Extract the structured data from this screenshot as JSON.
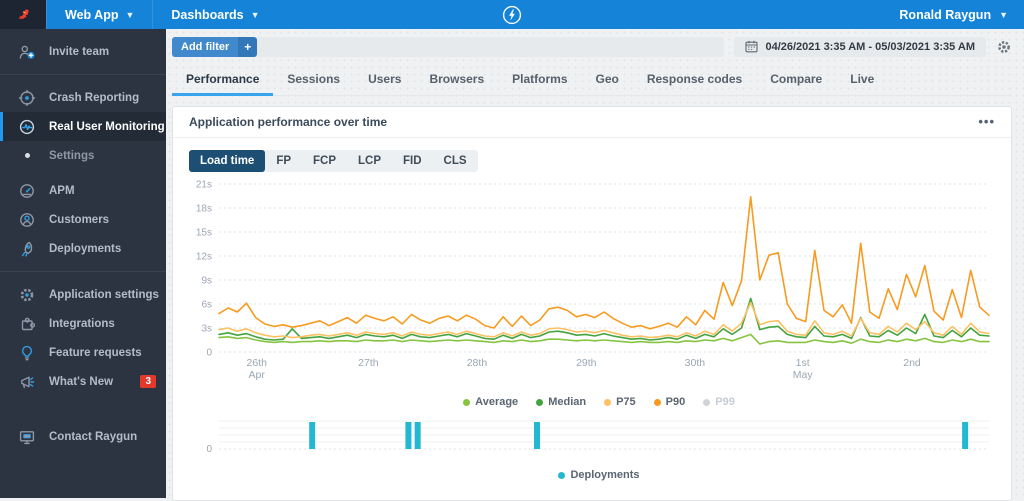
{
  "topbar": {
    "app_label": "Web App",
    "dashboards_label": "Dashboards",
    "user_name": "Ronald Raygun",
    "accent_color": "#1583d7"
  },
  "sidebar": {
    "items": [
      {
        "label": "Invite team",
        "icon": "invite-team-icon"
      },
      {
        "label": "Crash Reporting",
        "icon": "crash-reporting-icon"
      },
      {
        "label": "Real User Monitoring",
        "icon": "real-user-monitoring-icon",
        "active": true
      },
      {
        "label": "Settings",
        "icon": "bullet-dot"
      },
      {
        "label": "APM",
        "icon": "apm-gauge-icon"
      },
      {
        "label": "Customers",
        "icon": "customers-icon"
      },
      {
        "label": "Deployments",
        "icon": "rocket-icon"
      },
      {
        "label": "Application settings",
        "icon": "gear-icon"
      },
      {
        "label": "Integrations",
        "icon": "puzzle-icon"
      },
      {
        "label": "Feature requests",
        "icon": "lightbulb-icon"
      },
      {
        "label": "What's New",
        "icon": "megaphone-icon",
        "badge": "3"
      },
      {
        "label": "Contact Raygun",
        "icon": "contact-icon"
      }
    ]
  },
  "filter_bar": {
    "add_filter_label": "Add filter",
    "plus_label": "+",
    "date_range": "04/26/2021 3:35 AM - 05/03/2021 3:35 AM"
  },
  "tabs": [
    {
      "label": "Performance",
      "active": true
    },
    {
      "label": "Sessions"
    },
    {
      "label": "Users"
    },
    {
      "label": "Browsers"
    },
    {
      "label": "Platforms"
    },
    {
      "label": "Geo"
    },
    {
      "label": "Response codes"
    },
    {
      "label": "Compare"
    },
    {
      "label": "Live"
    }
  ],
  "card": {
    "title": "Application performance over time",
    "menu_label": "•••"
  },
  "toggles": [
    {
      "label": "Load time",
      "active": true
    },
    {
      "label": "FP"
    },
    {
      "label": "FCP"
    },
    {
      "label": "LCP"
    },
    {
      "label": "FID"
    },
    {
      "label": "CLS"
    }
  ],
  "chart_data": {
    "type": "line",
    "title": "Application performance over time",
    "unit": "seconds",
    "ylim": [
      0,
      21
    ],
    "yticks": [
      0,
      3,
      6,
      9,
      12,
      15,
      18,
      21
    ],
    "ytick_labels": [
      "0",
      "3s",
      "6s",
      "9s",
      "12s",
      "15s",
      "18s",
      "21s"
    ],
    "grid": true,
    "legend_position": "bottom",
    "xtick_fracs": [
      0.049,
      0.194,
      0.335,
      0.477,
      0.618,
      0.758,
      0.9
    ],
    "xtick_labels": [
      [
        "26th",
        "Apr"
      ],
      [
        "27th"
      ],
      [
        "28th"
      ],
      [
        "29th"
      ],
      [
        "30th"
      ],
      [
        "1st",
        "May"
      ],
      [
        "2nd"
      ]
    ],
    "series": [
      {
        "name": "Average",
        "color": "#86c440",
        "values": [
          1.8,
          1.9,
          1.7,
          1.8,
          1.5,
          1.3,
          1.2,
          1.3,
          1.2,
          1.3,
          1.3,
          1.4,
          1.3,
          1.4,
          1.4,
          1.3,
          1.5,
          1.4,
          1.4,
          1.5,
          1.3,
          1.5,
          1.4,
          1.3,
          1.4,
          1.5,
          1.4,
          1.5,
          1.4,
          1.3,
          1.2,
          1.4,
          1.3,
          1.5,
          1.3,
          1.4,
          1.6,
          1.6,
          1.5,
          1.4,
          1.5,
          1.4,
          1.5,
          1.4,
          1.3,
          1.2,
          1.3,
          1.2,
          1.2,
          1.3,
          1.2,
          1.4,
          1.3,
          1.5,
          1.4,
          1.7,
          1.4,
          1.8,
          2.2,
          1.0,
          1.3,
          1.4,
          1.2,
          1.2,
          1.2,
          1.5,
          1.3,
          1.2,
          1.4,
          1.1,
          1.6,
          1.3,
          1.2,
          1.5,
          1.3,
          1.6,
          1.4,
          1.7,
          1.3,
          1.2,
          1.5,
          1.3,
          1.6,
          1.3,
          1.3
        ]
      },
      {
        "name": "Median",
        "color": "#44a340",
        "values": [
          2.2,
          2.4,
          2.1,
          2.3,
          1.9,
          1.6,
          1.5,
          1.6,
          2.9,
          1.7,
          1.8,
          1.9,
          1.7,
          1.9,
          2.1,
          1.8,
          2.2,
          2.0,
          1.9,
          2.1,
          1.7,
          2.2,
          1.9,
          1.8,
          2.0,
          2.2,
          1.9,
          2.3,
          2.0,
          1.7,
          1.6,
          2.1,
          1.7,
          2.2,
          1.8,
          2.0,
          2.5,
          2.6,
          2.4,
          2.1,
          2.2,
          2.0,
          2.3,
          2.0,
          1.8,
          1.6,
          1.7,
          1.5,
          1.6,
          1.8,
          1.6,
          2.1,
          1.7,
          2.2,
          1.9,
          2.9,
          2.2,
          3.0,
          6.7,
          2.8,
          3.1,
          3.2,
          2.2,
          1.9,
          1.8,
          3.2,
          2.0,
          1.9,
          2.2,
          1.7,
          4.3,
          2.0,
          1.9,
          2.7,
          2.1,
          3.0,
          2.3,
          4.7,
          2.0,
          1.8,
          2.7,
          1.9,
          3.0,
          2.1,
          2.0
        ]
      },
      {
        "name": "P75",
        "color": "#fbc163",
        "values": [
          2.8,
          3.0,
          2.6,
          2.9,
          2.4,
          2.1,
          1.9,
          2.0,
          1.8,
          1.9,
          2.1,
          2.2,
          2.0,
          2.2,
          2.4,
          2.1,
          2.5,
          2.3,
          2.2,
          2.4,
          2.0,
          2.5,
          2.2,
          2.1,
          2.3,
          2.5,
          2.2,
          2.6,
          2.3,
          2.0,
          1.9,
          2.4,
          2.0,
          2.5,
          2.1,
          2.3,
          2.9,
          3.0,
          2.8,
          2.5,
          2.6,
          2.4,
          2.7,
          2.4,
          2.1,
          1.9,
          2.0,
          1.8,
          1.9,
          2.1,
          1.9,
          2.4,
          2.0,
          2.6,
          2.2,
          3.4,
          2.6,
          3.6,
          6.2,
          3.4,
          3.8,
          3.9,
          2.6,
          2.2,
          2.1,
          3.9,
          2.4,
          2.2,
          2.6,
          2.0,
          4.2,
          2.4,
          2.2,
          3.2,
          2.5,
          3.6,
          2.8,
          3.8,
          2.4,
          2.1,
          3.2,
          2.2,
          3.6,
          2.5,
          2.3
        ]
      },
      {
        "name": "P90",
        "color": "#f79a1f",
        "values": [
          4.8,
          5.5,
          5.0,
          6.1,
          4.3,
          3.5,
          3.2,
          3.4,
          3.1,
          3.3,
          3.6,
          3.9,
          3.3,
          3.8,
          4.3,
          3.6,
          4.6,
          4.2,
          3.9,
          4.4,
          3.5,
          4.7,
          4.0,
          3.6,
          4.2,
          4.5,
          3.9,
          4.6,
          4.1,
          3.3,
          3.0,
          4.4,
          3.2,
          4.5,
          3.3,
          4.0,
          5.4,
          5.6,
          5.2,
          4.4,
          4.7,
          4.3,
          5.0,
          4.2,
          3.6,
          3.1,
          3.3,
          2.9,
          3.2,
          3.6,
          3.1,
          4.4,
          3.4,
          5.2,
          4.1,
          8.7,
          5.8,
          8.9,
          19.4,
          9.0,
          12.1,
          12.4,
          6.0,
          4.2,
          3.8,
          12.7,
          5.2,
          4.4,
          5.9,
          3.6,
          13.6,
          5.0,
          4.2,
          7.9,
          5.3,
          9.7,
          6.9,
          10.8,
          5.1,
          4.0,
          7.8,
          4.3,
          10.2,
          5.6,
          4.6
        ]
      },
      {
        "name": "P99",
        "color": "#cfd4d9",
        "disabled": true,
        "values": []
      }
    ]
  },
  "deployments_chart": {
    "type": "bar",
    "name": "Deployments",
    "color": "#22b8cf",
    "zero_label": "0",
    "positions_frac": [
      0.121,
      0.246,
      0.258,
      0.413,
      0.969
    ],
    "values": [
      1,
      1,
      1,
      1,
      1
    ]
  }
}
